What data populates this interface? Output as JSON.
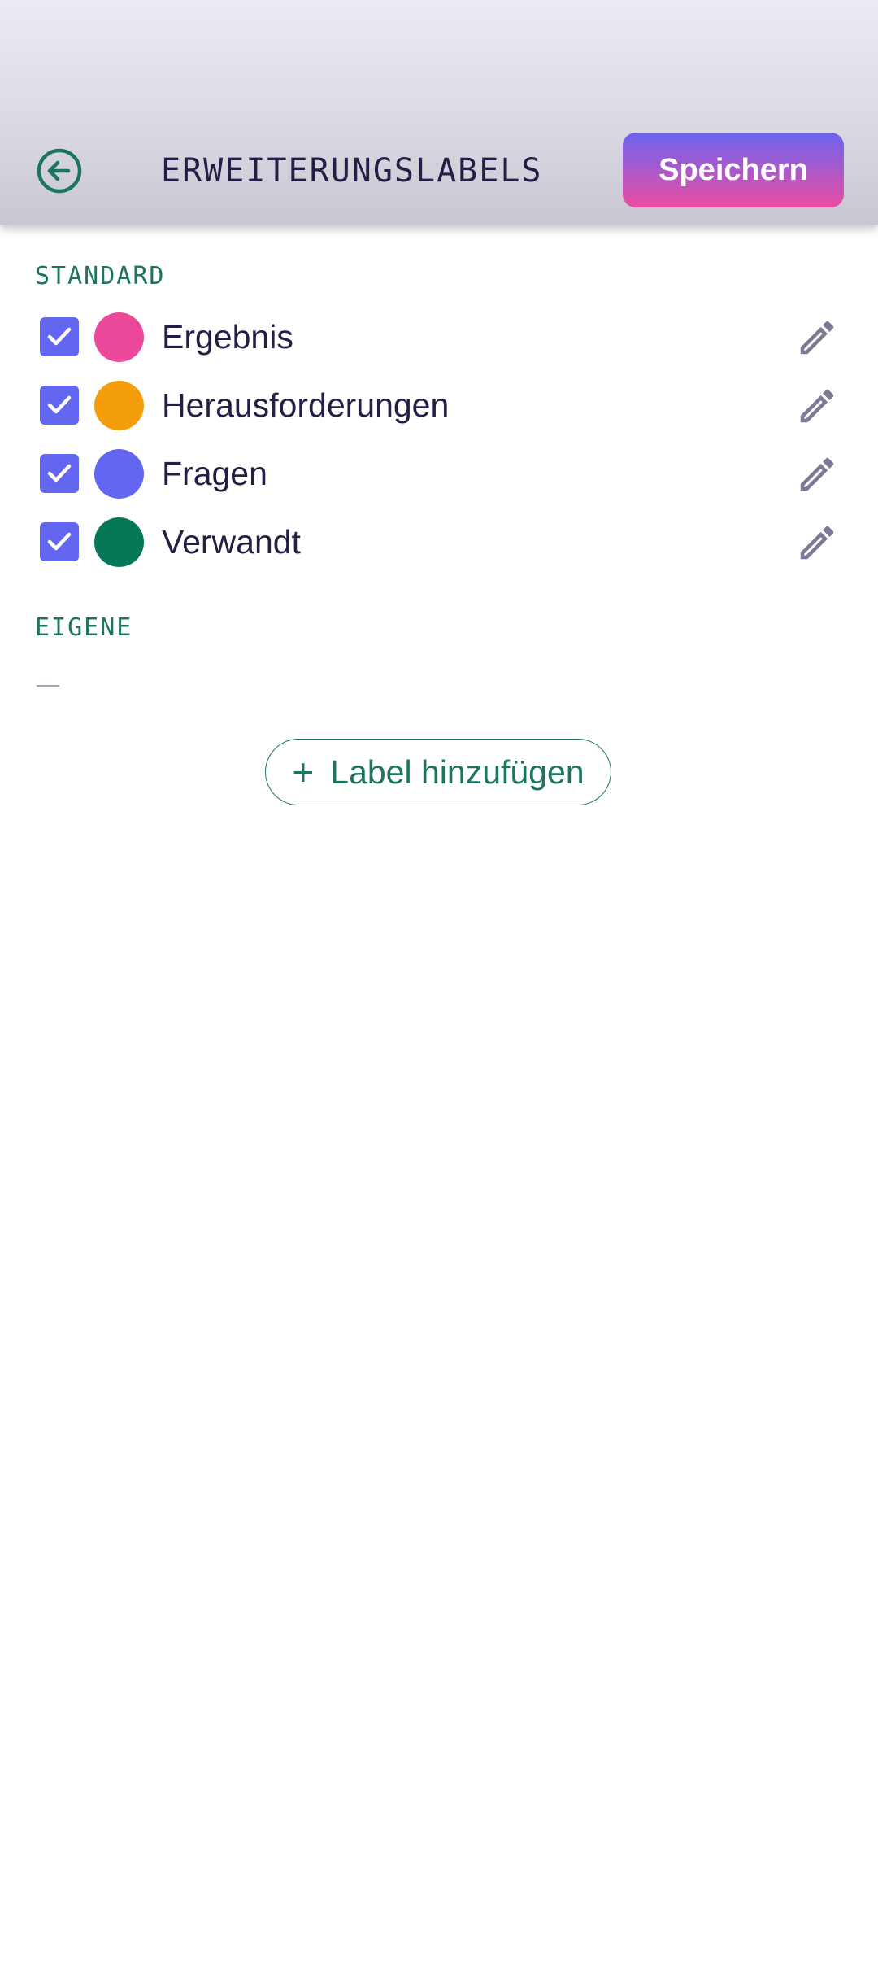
{
  "header": {
    "title": "ERWEITERUNGSLABELS",
    "save_label": "Speichern",
    "back_icon": "arrow-left-circle-icon"
  },
  "sections": {
    "standard": {
      "label": "STANDARD",
      "items": [
        {
          "label": "Ergebnis",
          "color": "#ec4899",
          "checked": true
        },
        {
          "label": "Herausforderungen",
          "color": "#f59e0b",
          "checked": true
        },
        {
          "label": "Fragen",
          "color": "#6366f1",
          "checked": true
        },
        {
          "label": "Verwandt",
          "color": "#047857",
          "checked": true
        }
      ]
    },
    "custom": {
      "label": "EIGENE",
      "empty_text": "—"
    }
  },
  "add_button": {
    "plus": "+",
    "label": "Label hinzufügen"
  },
  "colors": {
    "accent_teal": "#1d7561",
    "checkbox": "#6366f1",
    "title_text": "#221f45",
    "save_gradient_top": "#6b63ec",
    "save_gradient_bottom": "#ec4c9f"
  }
}
